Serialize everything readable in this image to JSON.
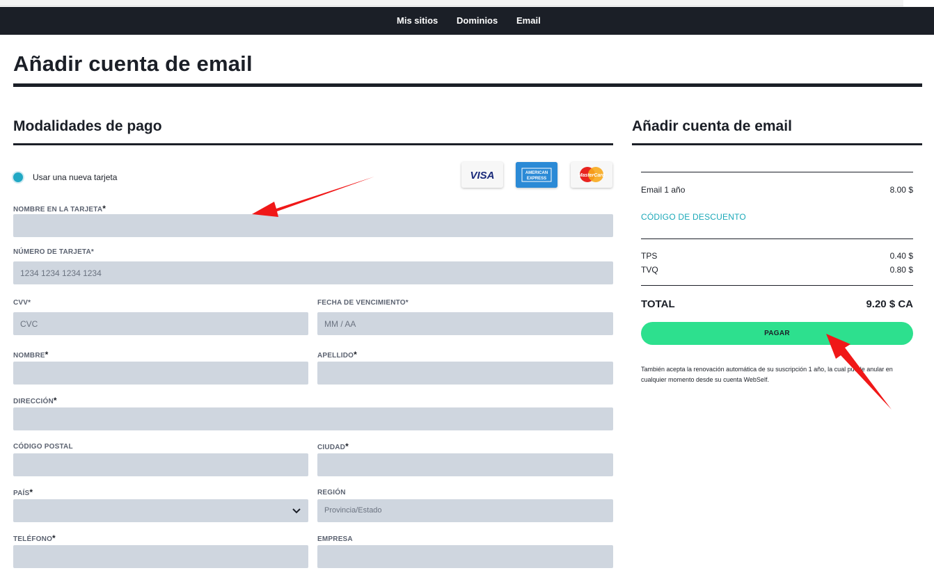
{
  "nav": {
    "items": [
      "Mis sitios",
      "Dominios",
      "Email"
    ]
  },
  "page_title": "Añadir cuenta de email",
  "payment": {
    "heading": "Modalidades de pago",
    "option_label": "Usar una nueva tarjeta",
    "cards": [
      "VISA",
      "AMERICAN EXPRESS",
      "MasterCard"
    ],
    "fields": {
      "card_name": {
        "label": "NOMBRE EN LA TARJETA",
        "required": "*",
        "placeholder": ""
      },
      "card_number": {
        "label": "NÚMERO DE TARJETA*",
        "placeholder": "1234 1234 1234 1234"
      },
      "cvv": {
        "label": "CVV*",
        "placeholder": "CVC"
      },
      "expiry": {
        "label": "FECHA DE VENCIMIENTO*",
        "placeholder": "MM / AA"
      },
      "first_name": {
        "label": "NOMBRE",
        "required": "*"
      },
      "last_name": {
        "label": "APELLIDO",
        "required": "*"
      },
      "address": {
        "label": "DIRECCIÓN",
        "required": "*"
      },
      "postal_code": {
        "label": "CÓDIGO POSTAL"
      },
      "city": {
        "label": "CIUDAD",
        "required": "*"
      },
      "country": {
        "label": "PAÍS",
        "required": "*",
        "value": ""
      },
      "region": {
        "label": "REGIÓN",
        "placeholder": "Provincia/Estado"
      },
      "phone": {
        "label": "TELÉFONO",
        "required": "*"
      },
      "company": {
        "label": "EMPRESA"
      }
    }
  },
  "summary": {
    "heading": "Añadir cuenta de email",
    "item_label": "Email 1 año",
    "item_price": "8.00 $",
    "discount_link": "CÓDIGO DE DESCUENTO",
    "taxes": [
      {
        "label": "TPS",
        "value": "0.40 $"
      },
      {
        "label": "TVQ",
        "value": "0.80 $"
      }
    ],
    "total_label": "TOTAL",
    "total_value": "9.20 $ CA",
    "pay_button": "PAGAR",
    "notice": "También acepta la renovación automática de su suscripción 1 año, la cual puede anular en cualquier momento desde su cuenta WebSelf."
  },
  "colors": {
    "navbar": "#1b1f27",
    "field_bg": "#cfd6df",
    "pay_button": "#2de08e",
    "link": "#1aa8b8",
    "radio": "#21a8c4",
    "annotation_arrow": "#f01818"
  },
  "icons": [
    "radio-selected-icon",
    "visa-card-icon",
    "amex-card-icon",
    "mastercard-icon",
    "chevron-down-icon",
    "annotation-arrow"
  ]
}
